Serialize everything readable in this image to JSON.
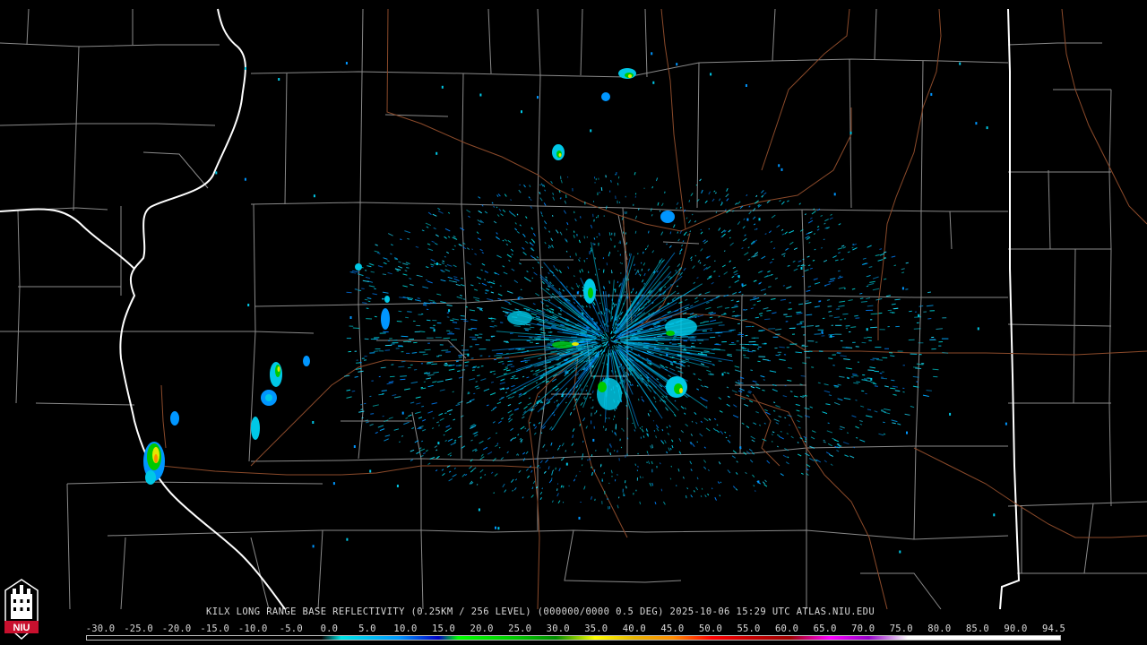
{
  "caption": {
    "text": "KILX LONG RANGE BASE REFLECTIVITY (0.25KM / 256 LEVEL) (000000/0000 0.5 DEG) 2025-10-06 15:29 UTC  ATLAS.NIU.EDU"
  },
  "color_scale": {
    "labels": [
      "-30.0",
      "-25.0",
      "-20.0",
      "-15.0",
      "-10.0",
      "-5.0",
      "0.0",
      "5.0",
      "10.0",
      "15.0",
      "20.0",
      "25.0",
      "30.0",
      "35.0",
      "40.0",
      "45.0",
      "50.0",
      "55.0",
      "60.0",
      "65.0",
      "70.0",
      "75.0",
      "80.0",
      "85.0",
      "90.0",
      "94.5"
    ],
    "stops": [
      {
        "dbz": -30.0,
        "color": "#000000"
      },
      {
        "dbz": 0.0,
        "color": "#000000"
      },
      {
        "dbz": 2.5,
        "color": "#00e6e6"
      },
      {
        "dbz": 10.0,
        "color": "#0096ff"
      },
      {
        "dbz": 15.0,
        "color": "#0000c8"
      },
      {
        "dbz": 17.5,
        "color": "#00ff00"
      },
      {
        "dbz": 25.0,
        "color": "#00c800"
      },
      {
        "dbz": 30.0,
        "color": "#008c00"
      },
      {
        "dbz": 35.0,
        "color": "#ffff00"
      },
      {
        "dbz": 40.0,
        "color": "#e6b400"
      },
      {
        "dbz": 45.0,
        "color": "#ff8c00"
      },
      {
        "dbz": 50.0,
        "color": "#ff0000"
      },
      {
        "dbz": 55.0,
        "color": "#c80000"
      },
      {
        "dbz": 60.0,
        "color": "#a00000"
      },
      {
        "dbz": 65.0,
        "color": "#ff00ff"
      },
      {
        "dbz": 70.0,
        "color": "#9600c8"
      },
      {
        "dbz": 75.0,
        "color": "#ffffff"
      },
      {
        "dbz": 94.5,
        "color": "#ffffff"
      }
    ]
  },
  "logo": {
    "text": "NIU",
    "color": "#c8102e"
  },
  "colors": {
    "county_border": "#8a8a8a",
    "state_border": "#ffffff",
    "highway": "#8b4a2a",
    "background": "#000000"
  }
}
